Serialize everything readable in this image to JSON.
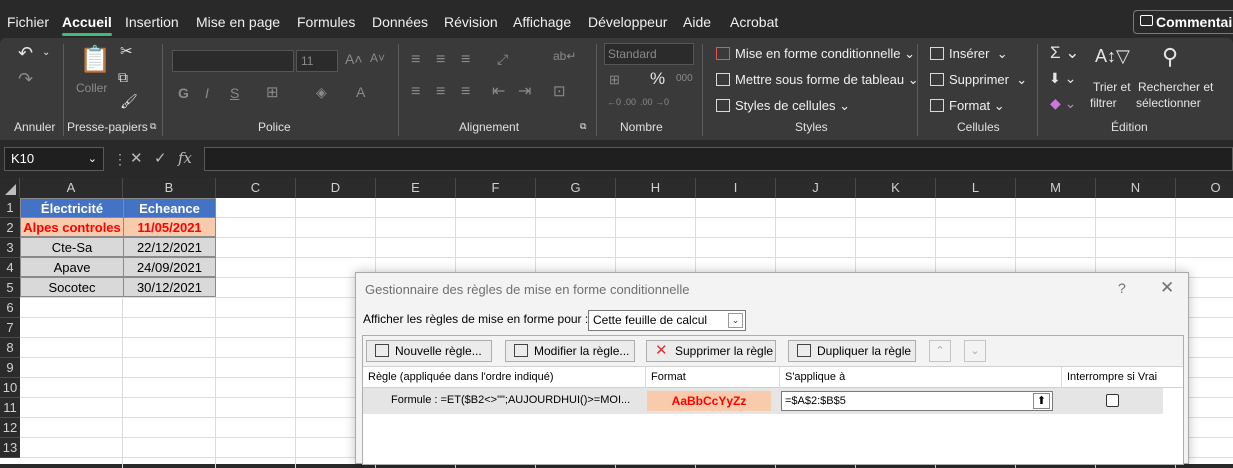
{
  "menu": {
    "tabs": [
      "Fichier",
      "Accueil",
      "Insertion",
      "Mise en page",
      "Formules",
      "Données",
      "Révision",
      "Affichage",
      "Développeur",
      "Aide",
      "Acrobat"
    ],
    "active": "Accueil",
    "comments": "Commentaires"
  },
  "ribbon": {
    "groups": [
      "Annuler",
      "Presse-papiers",
      "Police",
      "Alignement",
      "Nombre",
      "Styles",
      "Cellules",
      "Édition"
    ],
    "paste": "Coller",
    "font_size": "11",
    "number_format": "Standard",
    "styles": {
      "conditional": "Mise en forme conditionnelle",
      "table": "Mettre sous forme de tableau",
      "cell_styles": "Styles de cellules"
    },
    "cells": {
      "insert": "Insérer",
      "delete": "Supprimer",
      "format": "Format"
    },
    "editing": {
      "sort_line1": "Trier et",
      "sort_line2": "filtrer",
      "find_line1": "Rechercher et",
      "find_line2": "sélectionner"
    },
    "font_buttons": {
      "bold": "G",
      "italic": "I",
      "underline": "S"
    }
  },
  "formula_bar": {
    "name_box": "K10",
    "fx": "fx",
    "formula": ""
  },
  "sheet": {
    "columns": [
      "A",
      "B",
      "C",
      "D",
      "E",
      "F",
      "G",
      "H",
      "I",
      "J",
      "K",
      "L",
      "M",
      "N",
      "O"
    ],
    "rows": [
      "1",
      "2",
      "3",
      "4",
      "5",
      "6",
      "7",
      "8",
      "9",
      "10",
      "11",
      "12",
      "13"
    ],
    "header": [
      "Électricité",
      "Echeance"
    ],
    "data": [
      [
        "Alpes controles",
        "11/05/2021"
      ],
      [
        "Cte-Sa",
        "22/12/2021"
      ],
      [
        "Apave",
        "24/09/2021"
      ],
      [
        "Socotec",
        "30/12/2021"
      ]
    ]
  },
  "dialog": {
    "title": "Gestionnaire des règles de mise en forme conditionnelle",
    "help": "?",
    "close": "✕",
    "show_label": "Afficher les règles de mise en forme pour :",
    "show_value": "Cette feuille de calcul",
    "buttons": {
      "new": "Nouvelle règle...",
      "edit": "Modifier la règle...",
      "delete": "Supprimer la règle",
      "duplicate": "Dupliquer la règle"
    },
    "columns": {
      "rule": "Règle (appliquée dans l'ordre indiqué)",
      "format": "Format",
      "applies": "S'applique à",
      "stop": "Interrompre si Vrai"
    },
    "rule": {
      "formula": "Formule : =ET($B2<>\"\";AUJOURDHUI()>=MOI...",
      "preview": "AaBbCcYyZz",
      "applies_to": "=$A$2:$B$5",
      "stop_if_true": false
    }
  },
  "colors": {
    "header_fill": "#4472c4",
    "highlight_fill": "#f8cbad",
    "highlight_text": "#ff0000",
    "accent": "#3fbb76"
  }
}
